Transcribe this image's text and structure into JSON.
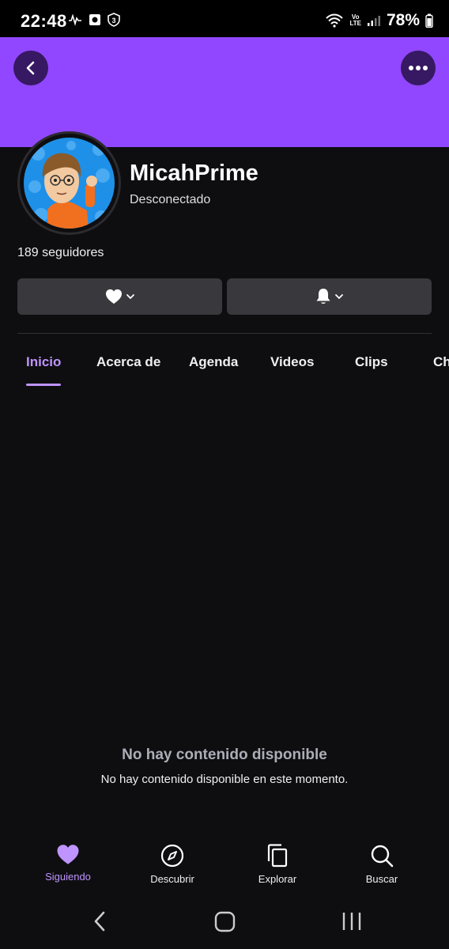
{
  "status_bar": {
    "time": "22:48",
    "battery": "78%",
    "volte_top": "Vo",
    "volte_bottom": "LTE",
    "notification_badge": "3"
  },
  "header": {
    "banner_color": "#9147ff",
    "back_icon": "chevron-left-icon",
    "more_icon": "more-horizontal-icon"
  },
  "channel": {
    "name": "MicahPrime",
    "status": "Desconectado",
    "followers": "189 seguidores"
  },
  "actions": {
    "follow_icon": "heart-icon",
    "notify_icon": "bell-icon"
  },
  "tabs": [
    {
      "label": "Inicio",
      "active": true
    },
    {
      "label": "Acerca de",
      "active": false
    },
    {
      "label": "Agenda",
      "active": false
    },
    {
      "label": "Videos",
      "active": false
    },
    {
      "label": "Clips",
      "active": false
    },
    {
      "label": "Ch",
      "active": false
    }
  ],
  "empty_state": {
    "title": "No hay contenido disponible",
    "subtitle": "No hay contenido disponible en este momento."
  },
  "bottom_nav": [
    {
      "label": "Siguiendo",
      "icon": "heart-icon",
      "active": true
    },
    {
      "label": "Descubrir",
      "icon": "compass-icon",
      "active": false
    },
    {
      "label": "Explorar",
      "icon": "copy-icon",
      "active": false
    },
    {
      "label": "Buscar",
      "icon": "search-icon",
      "active": false
    }
  ],
  "colors": {
    "accent": "#bf94ff",
    "background": "#0e0e10",
    "button": "#38383d"
  }
}
